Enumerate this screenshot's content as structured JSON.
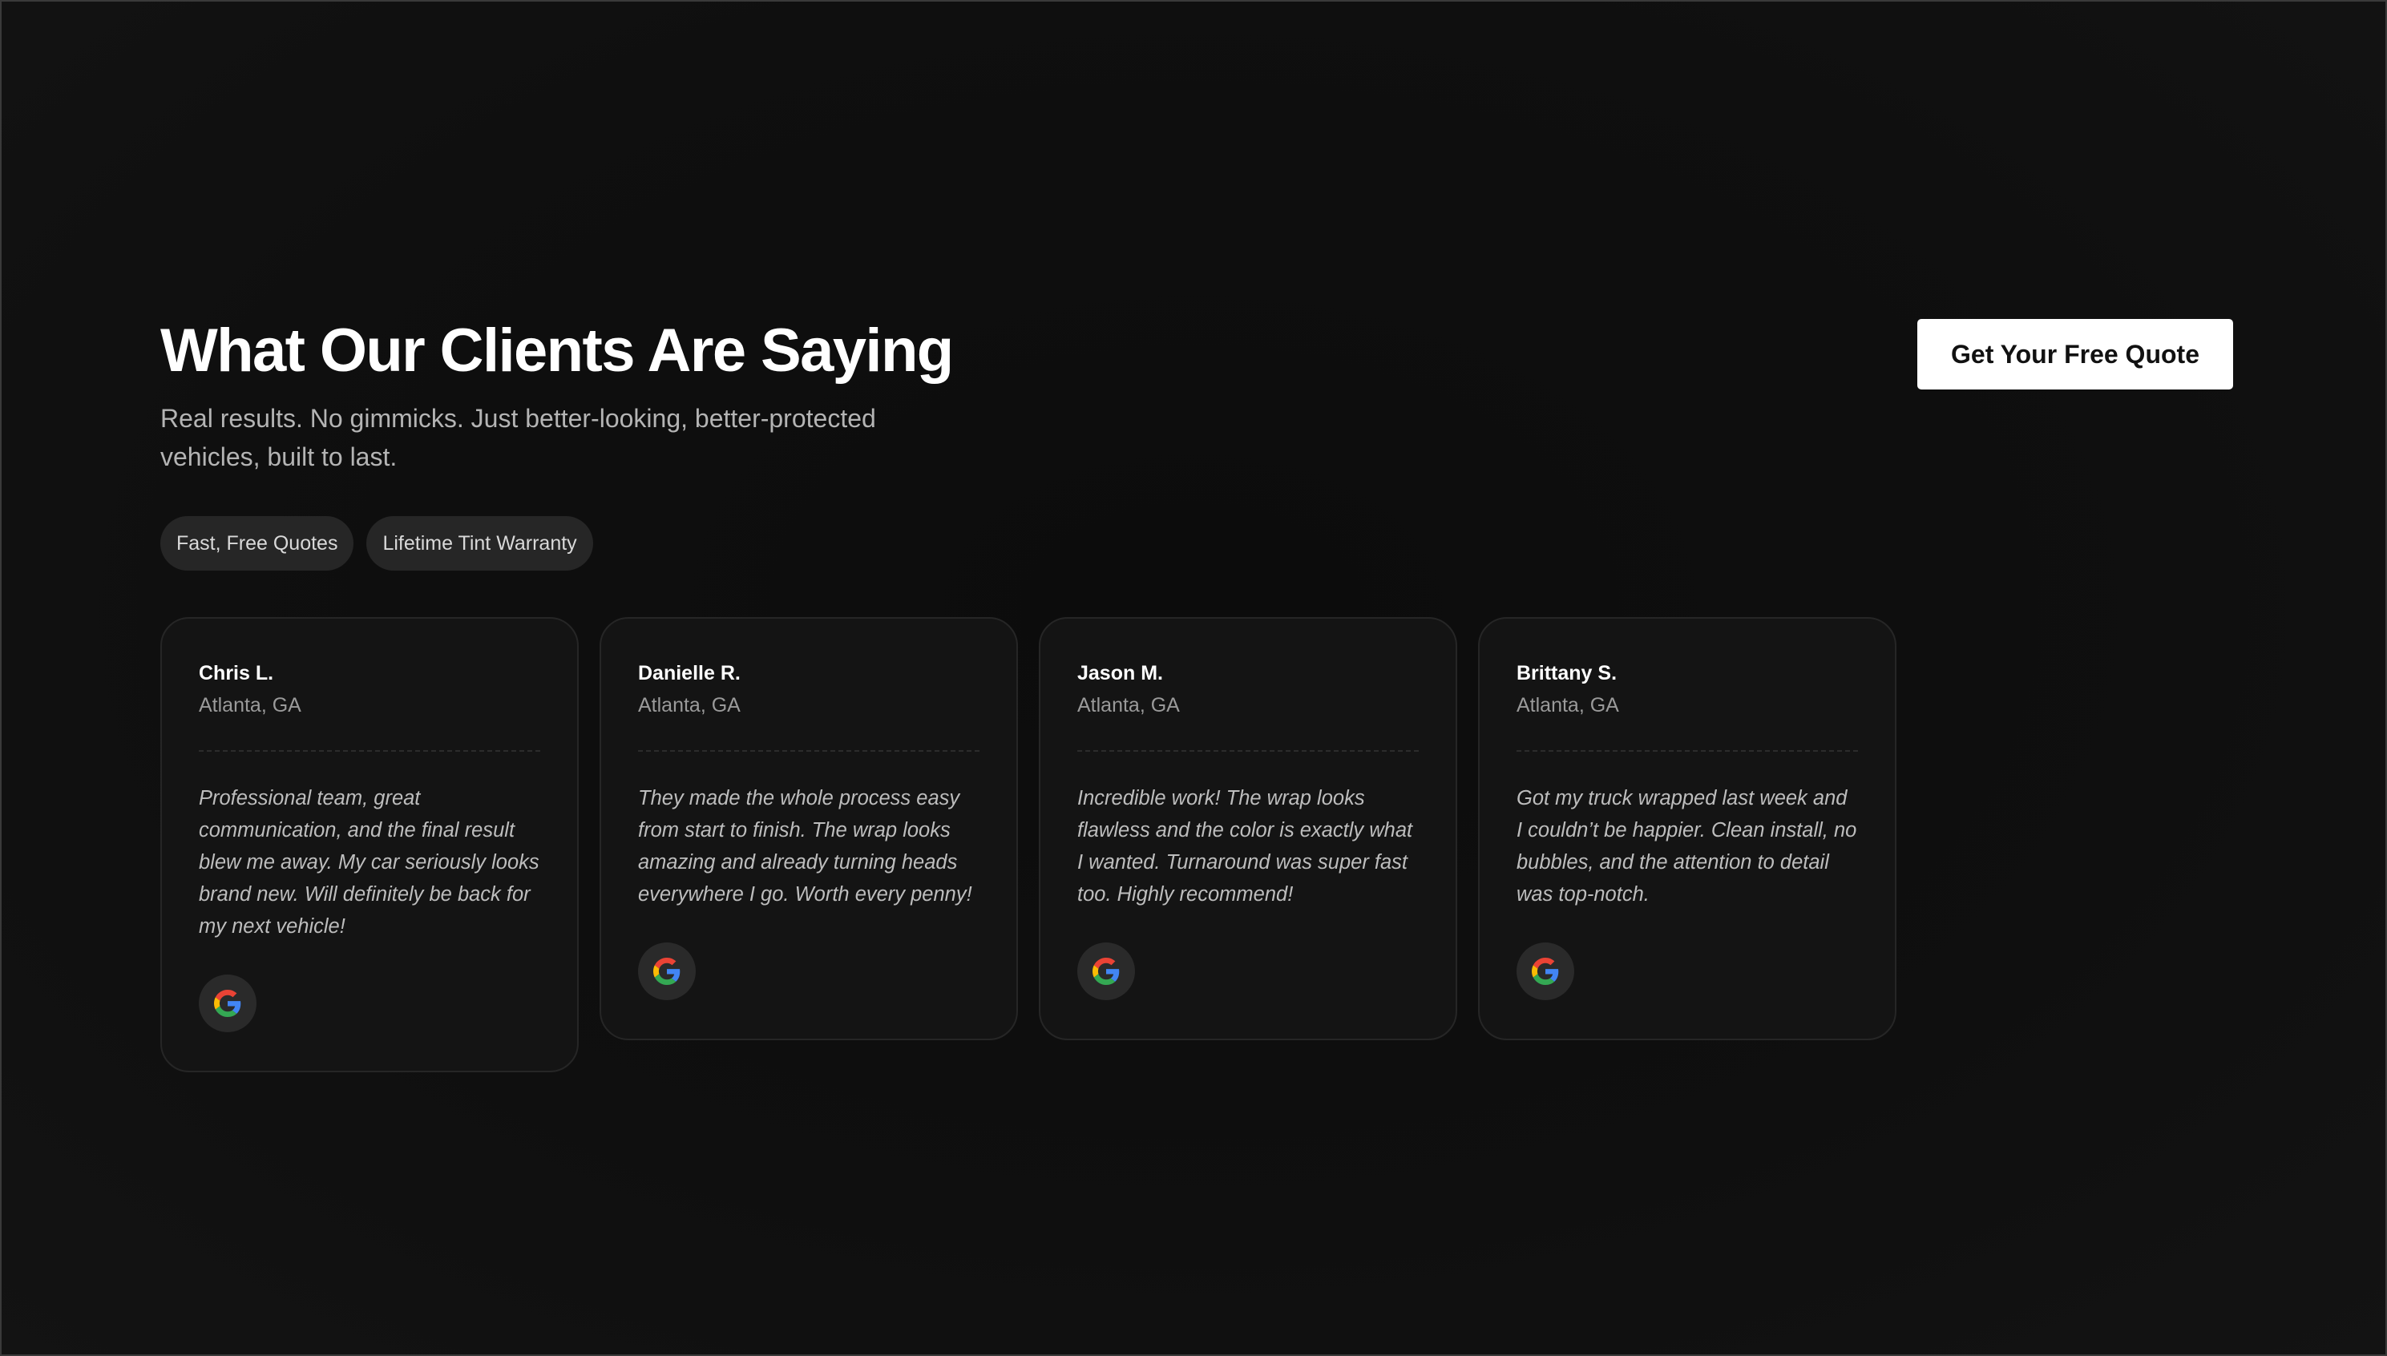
{
  "header": {
    "title": "What Our Clients Are Saying",
    "subtitle": "Real results. No gimmicks. Just better-looking, better-protected vehicles, built to last.",
    "cta_label": "Get Your Free Quote"
  },
  "badges": [
    {
      "label": "Fast, Free Quotes"
    },
    {
      "label": "Lifetime Tint Warranty"
    }
  ],
  "testimonials": [
    {
      "name": "Chris L.",
      "location": "Atlanta, GA",
      "text": "Professional team, great communication, and the final result blew me away. My car seriously looks brand new. Will definitely be back for my next vehicle!",
      "source_icon": "google-icon"
    },
    {
      "name": "Danielle R.",
      "location": "Atlanta, GA",
      "text": "They made the whole process easy from start to finish. The wrap looks amazing and already turning heads everywhere I go. Worth every penny!",
      "source_icon": "google-icon"
    },
    {
      "name": "Jason M.",
      "location": "Atlanta, GA",
      "text": "Incredible work! The wrap looks flawless and the color is exactly what I wanted. Turnaround was super fast too. Highly recommend!",
      "source_icon": "google-icon"
    },
    {
      "name": "Brittany S.",
      "location": "Atlanta, GA",
      "text": "Got my truck wrapped last week and I couldn’t be happier. Clean install, no bubbles, and the attention to detail was top-notch.",
      "source_icon": "google-icon"
    }
  ],
  "colors": {
    "background": "#0f0f0f",
    "card": "#141414",
    "badge": "#262626",
    "cta_bg": "#ffffff",
    "google_blue": "#4285F4",
    "google_red": "#EA4335",
    "google_yellow": "#FBBC05",
    "google_green": "#34A853"
  }
}
